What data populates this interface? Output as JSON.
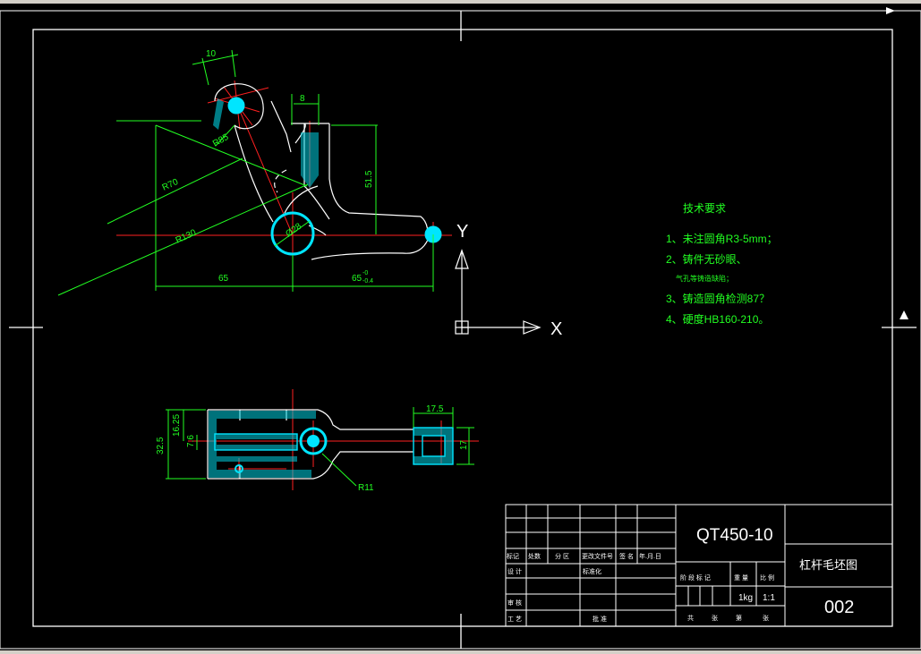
{
  "drawing": {
    "dimensions": {
      "d10": "10",
      "d8": "8",
      "r85": "R85",
      "r70": "R70",
      "r130": "R130",
      "dia28": "Ø28",
      "d51_5": "51.5",
      "d65": "65",
      "d65tol": "65",
      "tol_upper": "-0",
      "tol_lower": "-0.4",
      "d17_5": "17.5",
      "d17": "17",
      "d32_5": "32.5",
      "d16_25": "16.25",
      "d7_6": "7.6",
      "r11": "R11"
    },
    "ucs": {
      "x_label": "X",
      "y_label": "Y"
    }
  },
  "tech_requirements": {
    "title": "技术要求",
    "items": [
      "1、未注圆角R3-5mm；",
      "2、铸件无砂眼、",
      "气孔等铸造缺陷；",
      "3、铸造圆角检测87？",
      "4、硬度HB160-210。"
    ]
  },
  "title_block": {
    "material": "QT450-10",
    "part_name": "杠杆毛坯图",
    "drawing_no": "002",
    "weight": "1kg",
    "scale": "1:1",
    "header_cells": [
      "标记",
      "处数",
      "分 区",
      "更改文件号",
      "签 名",
      "年.月.日"
    ],
    "row_design": "设 计",
    "row_std": "标准化",
    "row_review": "审 核",
    "row_craft": "工 艺",
    "row_approve": "批 准",
    "stage_labels": [
      "阶 段 标 记",
      "重 量",
      "比 例"
    ],
    "sheet_labels": [
      "共",
      "张",
      "第",
      "张"
    ]
  }
}
